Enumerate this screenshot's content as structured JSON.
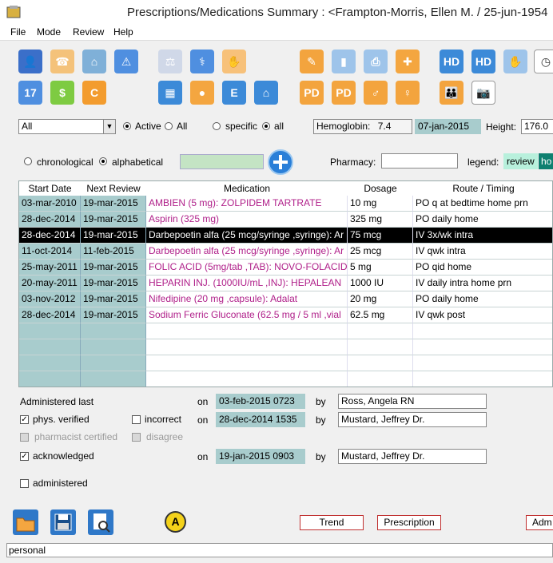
{
  "window": {
    "title": "Prescriptions/Medications Summary :   <Frampton-Morris, Ellen M. / 25-jun-1954"
  },
  "menu": [
    "File",
    "Mode",
    "Review",
    "Help"
  ],
  "toolbar_icons": [
    {
      "name": "patient-icon",
      "color": "#3b6fc9",
      "glyph": "👤"
    },
    {
      "name": "phone-icon",
      "color": "#f4c27a",
      "glyph": "☎"
    },
    {
      "name": "home-icon",
      "color": "#7fb0d8",
      "glyph": "⌂"
    },
    {
      "name": "warning-icon",
      "color": "#4f8fe0",
      "glyph": "⚠"
    },
    {
      "name": "gavel-icon",
      "color": "#d0d8e8",
      "glyph": "⚖"
    },
    {
      "name": "stethoscope-icon",
      "color": "#4f8fe0",
      "glyph": "⚕"
    },
    {
      "name": "handshake-icon",
      "color": "#f7c17a",
      "glyph": "✋"
    },
    {
      "name": "notes-icon",
      "color": "#f3a43e",
      "glyph": "✎"
    },
    {
      "name": "bar-chart-icon",
      "color": "#9ec4ea",
      "glyph": "▮"
    },
    {
      "name": "printer-icon",
      "color": "#9ec4ea",
      "glyph": "⎙"
    },
    {
      "name": "first-aid-icon",
      "color": "#f4a640",
      "glyph": "✚"
    },
    {
      "name": "hd-icon",
      "color": "#3c8ad8",
      "glyph": "HD"
    },
    {
      "name": "hd2-icon",
      "color": "#3c8ad8",
      "glyph": "HD"
    },
    {
      "name": "hand-icon",
      "color": "#9ec4ea",
      "glyph": "✋"
    },
    {
      "name": "clock-icon",
      "color": "#fff",
      "glyph": "◷"
    },
    {
      "name": "calendar-icon",
      "color": "#4f8fe0",
      "glyph": "17"
    },
    {
      "name": "dollar-icon",
      "color": "#7ecb42",
      "glyph": "$"
    },
    {
      "name": "c-icon",
      "color": "#f39c2e",
      "glyph": "C"
    },
    {
      "name": "puzzle-icon",
      "color": "#3c8ad8",
      "glyph": "▦"
    },
    {
      "name": "apple-icon",
      "color": "#f4a640",
      "glyph": "●"
    },
    {
      "name": "ie-icon",
      "color": "#3c8ad8",
      "glyph": "E"
    },
    {
      "name": "house-icon",
      "color": "#3c8ad8",
      "glyph": "⌂"
    },
    {
      "name": "pd-icon",
      "color": "#f3a43e",
      "glyph": "PD"
    },
    {
      "name": "pd2-icon",
      "color": "#f3a43e",
      "glyph": "PD"
    },
    {
      "name": "body-front-icon",
      "color": "#f3a43e",
      "glyph": "♂"
    },
    {
      "name": "body-back-icon",
      "color": "#f3a43e",
      "glyph": "♀"
    },
    {
      "name": "family-icon",
      "color": "#f3a43e",
      "glyph": "👪"
    },
    {
      "name": "camera-icon",
      "color": "#fff",
      "glyph": "📷"
    }
  ],
  "filter": {
    "status_select": "All",
    "radio_active": "Active",
    "radio_all": "All",
    "radio_specific": "specific",
    "radio_all2": "all",
    "hemoglobin_label": "Hemoglobin:",
    "hemoglobin_value": "7.4",
    "hemoglobin_date": "07-jan-2015",
    "height_label": "Height:",
    "height_value": "176.0"
  },
  "sort": {
    "chronological": "chronological",
    "alphabetical": "alphabetical",
    "pharmacy_label": "Pharmacy:",
    "legend_label": "legend:",
    "legend_review": "review",
    "legend_ho": "ho"
  },
  "table": {
    "headers": [
      "Start Date",
      "Next Review",
      "Medication",
      "Dosage",
      "Route / Timing"
    ],
    "rows": [
      {
        "start": "03-mar-2010",
        "review": "19-mar-2015",
        "med": "AMBIEN (5 mg): ZOLPIDEM TARTRATE",
        "dose": "10 mg",
        "route": "PO q at bedtime  home prn"
      },
      {
        "start": "28-dec-2014",
        "review": "19-mar-2015",
        "med": "Aspirin (325 mg)",
        "dose": "325 mg",
        "route": "PO daily  home"
      },
      {
        "start": "28-dec-2014",
        "review": "19-mar-2015",
        "med": "Darbepoetin alfa (25 mcg/syringe ,syringe): Ar",
        "dose": "75 mcg",
        "route": "IV 3x/wk  intra"
      },
      {
        "start": "11-oct-2014",
        "review": "11-feb-2015",
        "med": "Darbepoetin alfa (25 mcg/syringe ,syringe): Ar",
        "dose": "25 mcg",
        "route": "IV qwk  intra"
      },
      {
        "start": "25-may-2011",
        "review": "19-mar-2015",
        "med": "FOLIC ACID (5mg/tab ,TAB): NOVO-FOLACID",
        "dose": "5 mg",
        "route": "PO qid  home"
      },
      {
        "start": "20-may-2011",
        "review": "19-mar-2015",
        "med": "HEPARIN INJ. (1000IU/mL ,INJ): HEPALEAN",
        "dose": "1000 IU",
        "route": "IV daily  intra home prn"
      },
      {
        "start": "03-nov-2012",
        "review": "19-mar-2015",
        "med": "Nifedipine (20 mg ,capsule): Adalat",
        "dose": "20 mg",
        "route": "PO daily  home"
      },
      {
        "start": "28-dec-2014",
        "review": "19-mar-2015",
        "med": "Sodium Ferric Gluconate (62.5 mg / 5 ml ,vial",
        "dose": "62.5 mg",
        "route": "IV qwk  post"
      }
    ]
  },
  "details": {
    "administered_last": "Administered last",
    "on": "on",
    "by": "by",
    "admin_date": "03-feb-2015 0723",
    "admin_by": "Ross, Angela RN",
    "phys_verified": "phys. verified",
    "incorrect": "incorrect",
    "verified_date": "28-dec-2014 1535",
    "verified_by": "Mustard, Jeffrey Dr.",
    "pharmacist_certified": "pharmacist certified",
    "disagree": "disagree",
    "acknowledged": "acknowledged",
    "ack_date": "19-jan-2015 0903",
    "ack_by": "Mustard, Jeffrey Dr.",
    "administered": "administered"
  },
  "buttons": {
    "trend": "Trend",
    "prescription": "Prescription",
    "adm": "Adm"
  },
  "status": "personal"
}
